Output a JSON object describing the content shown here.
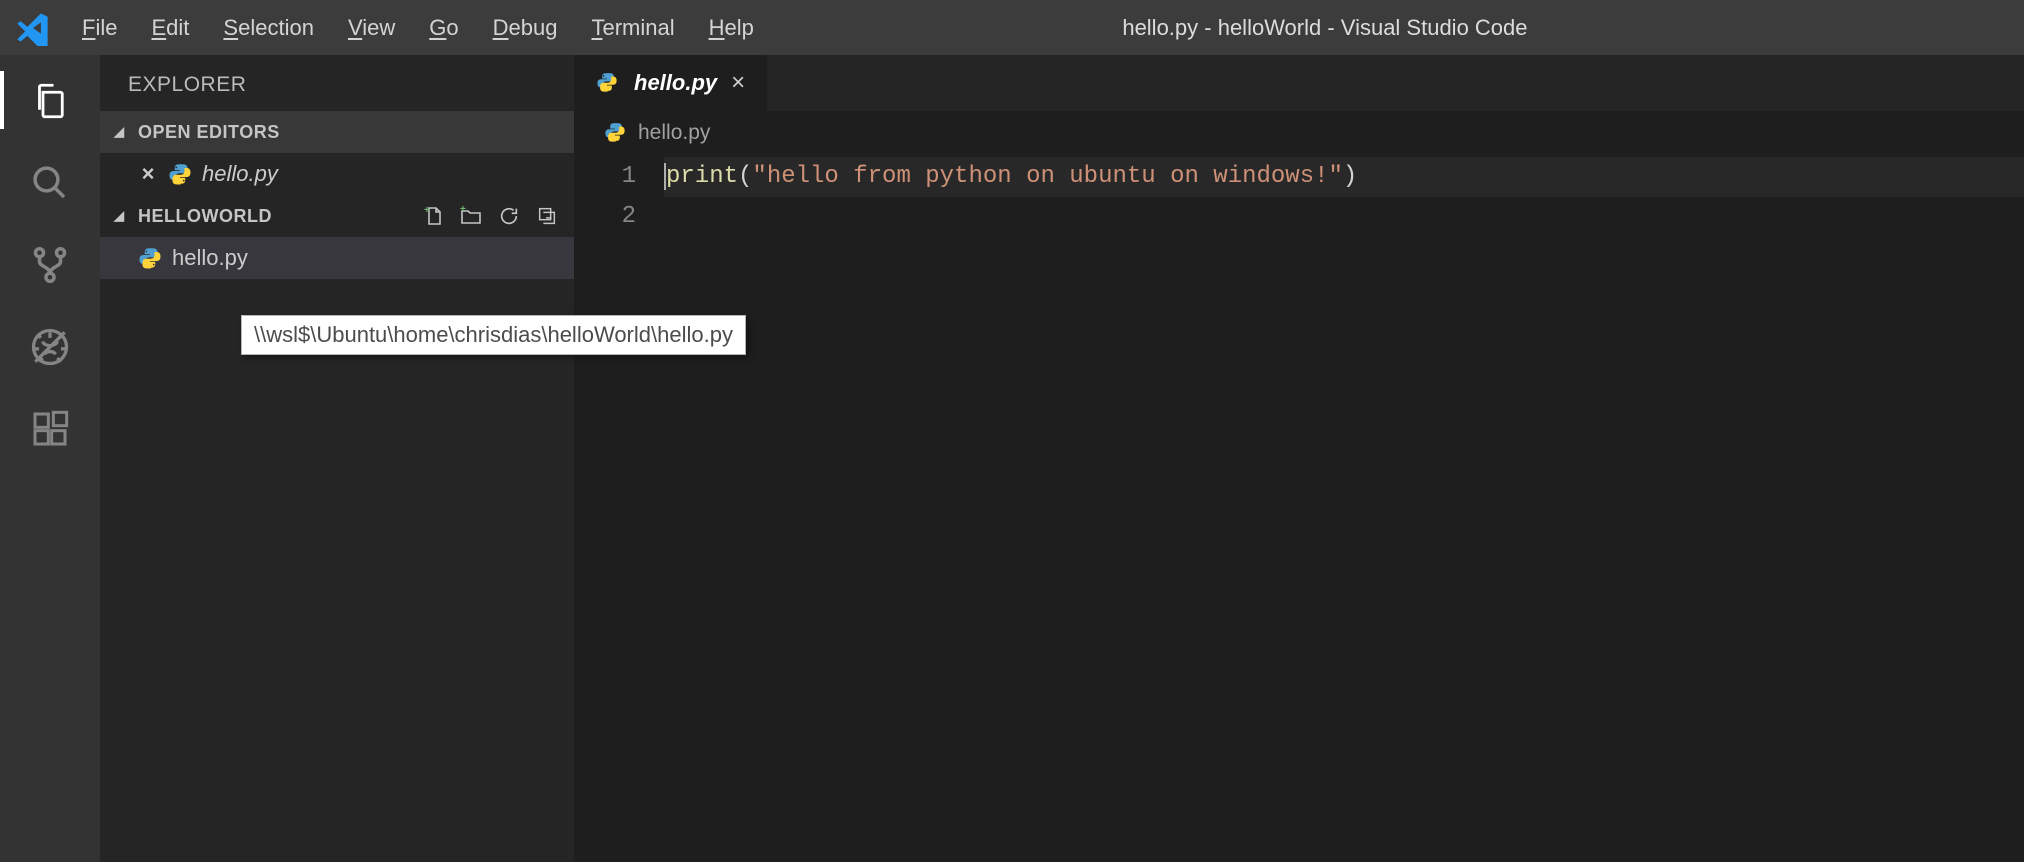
{
  "titlebar": {
    "title": "hello.py - helloWorld - Visual Studio Code"
  },
  "menu": {
    "file": "File",
    "edit": "Edit",
    "selection": "Selection",
    "view": "View",
    "go": "Go",
    "debug": "Debug",
    "terminal": "Terminal",
    "help": "Help"
  },
  "sidebar": {
    "title": "EXPLORER",
    "openEditors": {
      "label": "OPEN EDITORS",
      "items": [
        {
          "name": "hello.py"
        }
      ]
    },
    "workspace": {
      "label": "HELLOWORLD",
      "items": [
        {
          "name": "hello.py"
        }
      ]
    }
  },
  "editor": {
    "tab": {
      "name": "hello.py"
    },
    "breadcrumb": {
      "name": "hello.py"
    },
    "lines": {
      "n1": "1",
      "n2": "2",
      "code": {
        "fn": "print",
        "open": "(",
        "str": "\"hello from python on ubuntu on windows!\"",
        "close": ")"
      }
    }
  },
  "tooltip": {
    "text": "\\\\wsl$\\Ubuntu\\home\\chrisdias\\helloWorld\\hello.py"
  }
}
